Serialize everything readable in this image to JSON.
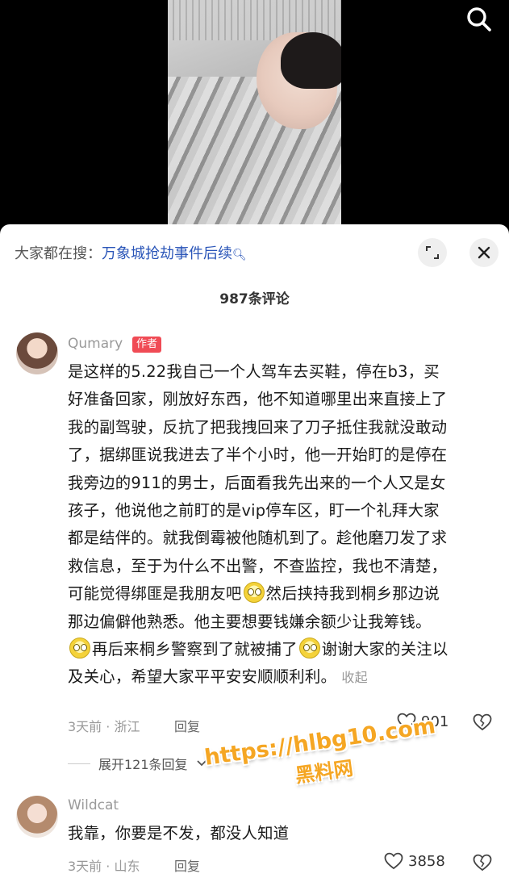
{
  "search": {
    "icon": "search-icon"
  },
  "trend": {
    "prefix": "大家都在搜：",
    "topic": "万象城抢劫事件后续",
    "icon": "search-icon"
  },
  "comment_count_title": "987条评论",
  "comments": [
    {
      "username": "Qumary",
      "tag": "作者",
      "lines": [
        "是这样的5.22我自己一个人驾车去买鞋，停在b3，买",
        "好准备回家，刚放好东西，他不知道哪里出来直接上了",
        "我的副驾驶，反抗了把我拽回来了刀子抵住我就没敢动",
        "了，据绑匪说我进去了半个小时，他一开始盯的是停在",
        "我旁边的911的男士，后面看我先出来的一个人又是女",
        "孩子，他说他之前盯的是vip停车区，盯一个礼拜大家",
        "都是结伴的。就我倒霉被他随机到了。趁他磨刀发了求",
        "救信息，至于为什么不出警，不查监控，我也不清楚，"
      ],
      "line9_a": "可能觉得绑匪是我朋友吧",
      "line9_b": "然后挟持我到桐乡那边说",
      "line10": "那边偏僻他熟悉。他主要想要钱嫌余额少让我筹钱。",
      "line11_a": "再后来桐乡警察到了就被捕了",
      "line11_b": "谢谢大家的关注以",
      "line12": "及关心，希望大家平平安安顺顺利利。",
      "collapse": "收起",
      "meta": "3天前 · 浙江",
      "reply": "回复",
      "likes": "901"
    },
    {
      "username": "Wildcat",
      "text": "我靠，你要是不发，都没人知道",
      "meta": "3天前 · 山东",
      "reply": "回复",
      "likes": "3858"
    }
  ],
  "expand_replies": "展开121条回复",
  "watermark": {
    "url": "https://hlbg10.com",
    "site": "黑料网"
  }
}
